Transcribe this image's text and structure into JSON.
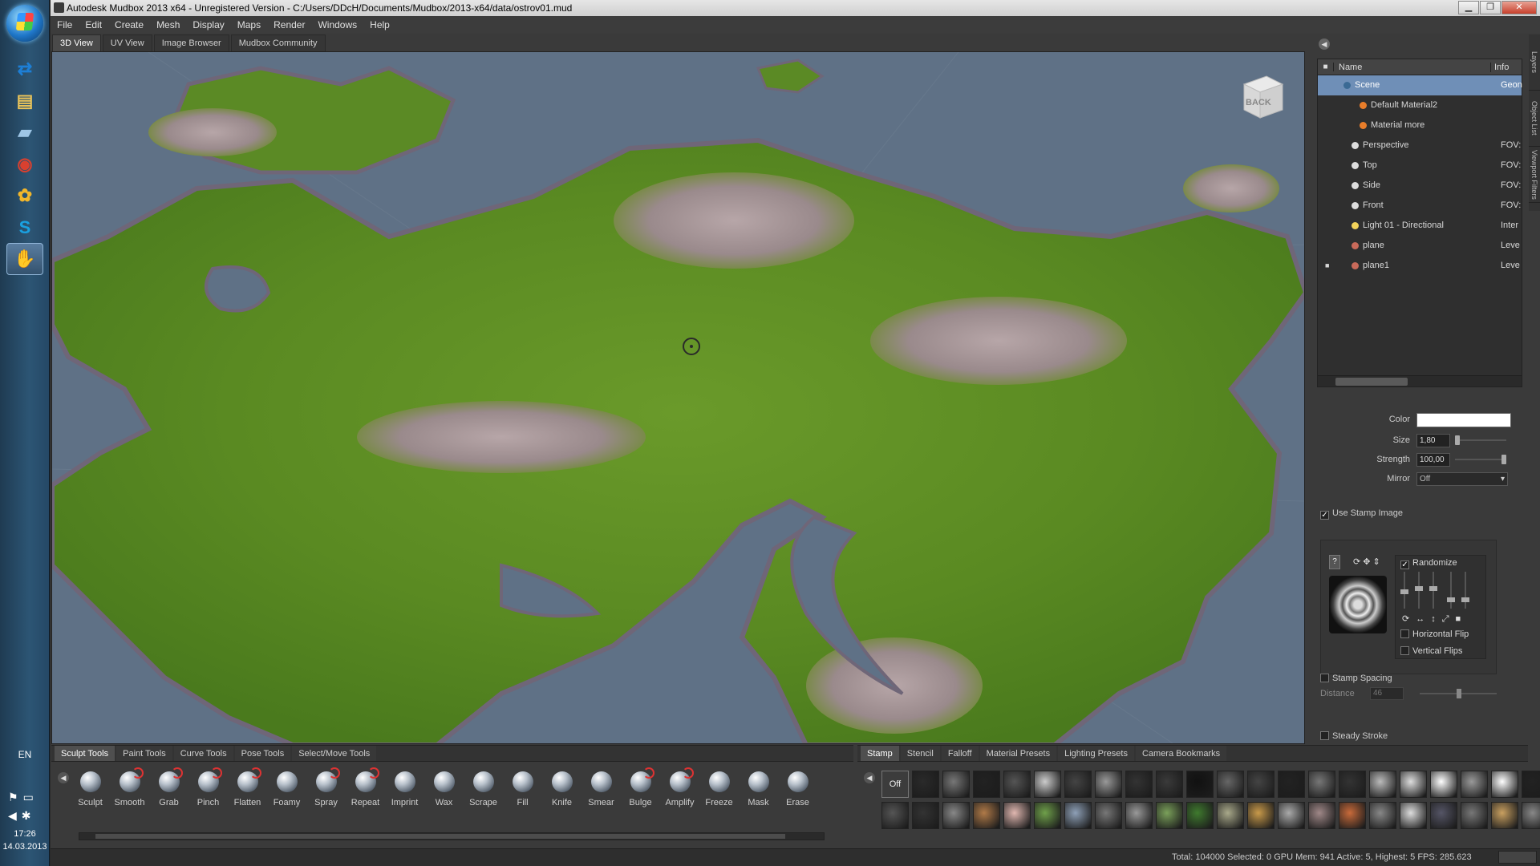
{
  "window": {
    "title": "Autodesk Mudbox 2013 x64 - Unregistered Version - C:/Users/DDcH/Documents/Mudbox/2013-x64/data/ostrov01.mud"
  },
  "taskbar": {
    "language": "EN",
    "time": "17:26",
    "date": "14.03.2013",
    "apps": [
      {
        "name": "teamviewer-icon",
        "glyph": "⇄",
        "color": "#1d7fd6"
      },
      {
        "name": "file-explorer-icon",
        "glyph": "▤",
        "color": "#e8c25a"
      },
      {
        "name": "notes-icon",
        "glyph": "▰",
        "color": "#9ec6e6"
      },
      {
        "name": "chrome-icon",
        "glyph": "◉",
        "color": "#d9402f"
      },
      {
        "name": "paint-icon",
        "glyph": "✿",
        "color": "#f2b62a"
      },
      {
        "name": "skype-icon",
        "glyph": "S",
        "color": "#1aa0e0"
      },
      {
        "name": "mudbox-icon",
        "glyph": "✋",
        "color": "#2f2f2f"
      }
    ]
  },
  "menu": [
    "File",
    "Edit",
    "Create",
    "Mesh",
    "Display",
    "Maps",
    "Render",
    "Windows",
    "Help"
  ],
  "view_tabs": [
    "3D View",
    "UV View",
    "Image Browser",
    "Mudbox Community"
  ],
  "viewcube_label": "BACK",
  "outliner": {
    "header": {
      "lock": "■",
      "name": "Name",
      "info": "Info"
    },
    "rows": [
      {
        "name": "Scene",
        "info": "Geon",
        "indent": 0,
        "icon": "#3b6a94",
        "selected": true,
        "locked": false
      },
      {
        "name": "Default Material2",
        "info": "",
        "indent": 2,
        "icon": "#e87d2a",
        "selected": false,
        "locked": false
      },
      {
        "name": "Material more",
        "info": "",
        "indent": 2,
        "icon": "#e87d2a",
        "selected": false,
        "locked": false
      },
      {
        "name": "Perspective",
        "info": "FOV:",
        "indent": 1,
        "icon": "#dddddd",
        "selected": false,
        "locked": false
      },
      {
        "name": "Top",
        "info": "FOV:",
        "indent": 1,
        "icon": "#dddddd",
        "selected": false,
        "locked": false
      },
      {
        "name": "Side",
        "info": "FOV:",
        "indent": 1,
        "icon": "#dddddd",
        "selected": false,
        "locked": false
      },
      {
        "name": "Front",
        "info": "FOV:",
        "indent": 1,
        "icon": "#dddddd",
        "selected": false,
        "locked": false
      },
      {
        "name": "Light 01 - Directional",
        "info": "Inter",
        "indent": 1,
        "icon": "#f3d35a",
        "selected": false,
        "locked": false
      },
      {
        "name": "plane",
        "info": "Leve",
        "indent": 1,
        "icon": "#c96a5a",
        "selected": false,
        "locked": false
      },
      {
        "name": "plane1",
        "info": "Leve",
        "indent": 1,
        "icon": "#c96a5a",
        "selected": false,
        "locked": true
      }
    ]
  },
  "properties": {
    "color_label": "Color",
    "size_label": "Size",
    "size_value": "1,80",
    "strength_label": "Strength",
    "strength_value": "100,00",
    "mirror_label": "Mirror",
    "mirror_value": "Off",
    "use_stamp_label": "Use Stamp Image",
    "randomize_label": "Randomize",
    "hflip_label": "Horizontal Flip",
    "vflip_label": "Vertical Flips",
    "stamp_spacing_label": "Stamp Spacing",
    "distance_label": "Distance",
    "distance_value": "46",
    "steady_stroke_label": "Steady Stroke",
    "help_glyph": "?"
  },
  "sidetabs": [
    "Layers",
    "Object List",
    "Viewport Filters"
  ],
  "sculpt_tabs": [
    "Sculpt Tools",
    "Paint Tools",
    "Curve Tools",
    "Pose Tools",
    "Select/Move Tools"
  ],
  "tools": [
    "Sculpt",
    "Smooth",
    "Grab",
    "Pinch",
    "Flatten",
    "Foamy",
    "Spray",
    "Repeat",
    "Imprint",
    "Wax",
    "Scrape",
    "Fill",
    "Knife",
    "Smear",
    "Bulge",
    "Amplify",
    "Freeze",
    "Mask",
    "Erase"
  ],
  "stamp_tabs": [
    "Stamp",
    "Stencil",
    "Falloff",
    "Material Presets",
    "Lighting Presets",
    "Camera Bookmarks"
  ],
  "stamp_off_label": "Off",
  "stamp_colors": [
    "#2a2a2a",
    "#777",
    "#222",
    "#555",
    "#ccc",
    "#444",
    "#999",
    "#333",
    "#3a3a3a",
    "#111",
    "#666",
    "#444",
    "#222",
    "#777",
    "#333",
    "#bbb",
    "#ddd",
    "#fff",
    "#999",
    "#fff",
    "#222",
    "#555",
    "#333",
    "#888",
    "#b07a48",
    "#e0b7b0",
    "#6fa04a",
    "#8ea0b7",
    "#777",
    "#999",
    "#7aa05a",
    "#3f7a2e",
    "#a9a98a",
    "#c99a4a",
    "#aaa",
    "#a08888",
    "#c86a3a",
    "#888",
    "#ddd",
    "#556",
    "#777",
    "#c9a060",
    "#888"
  ],
  "status": "Total: 104000   Selected: 0 GPU Mem: 941   Active: 5, Highest: 5   FPS: 285.623"
}
